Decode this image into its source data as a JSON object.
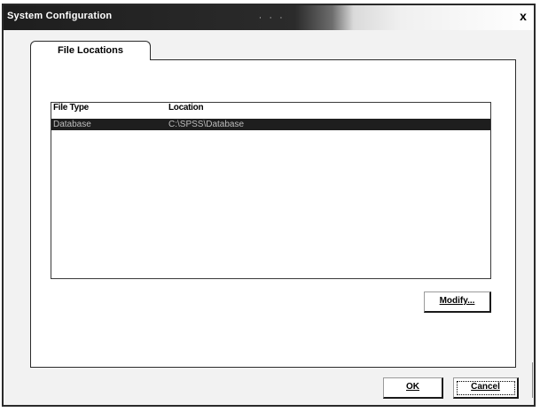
{
  "window": {
    "title": "System Configuration",
    "close_glyph": "x"
  },
  "tabs": [
    {
      "label": "File Locations",
      "selected": true
    }
  ],
  "list": {
    "columns": [
      "File Type",
      "Location"
    ],
    "rows": [
      {
        "file_type": "Database",
        "location": "C:\\SPSS\\Database",
        "selected": true
      }
    ]
  },
  "buttons": {
    "modify": "Modify...",
    "ok": "OK",
    "cancel": "Cancel"
  }
}
